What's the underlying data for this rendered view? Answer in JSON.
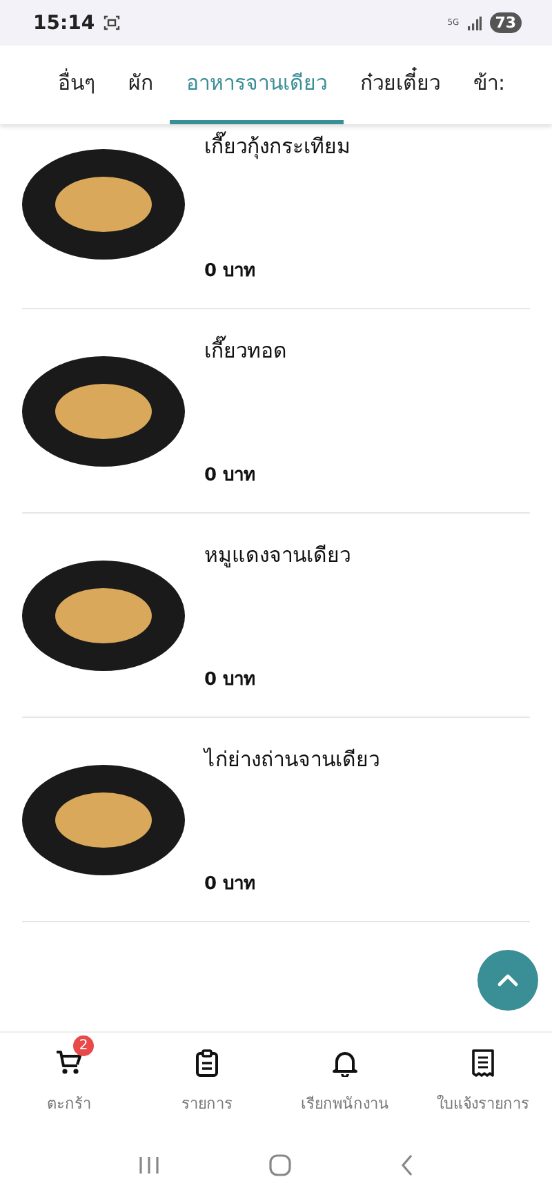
{
  "status_bar": {
    "time": "15:14",
    "network": "5G",
    "battery": "73"
  },
  "tabs": [
    {
      "label": "อื่นๆ",
      "selected": false
    },
    {
      "label": "ผัก",
      "selected": false
    },
    {
      "label": "อาหารจานเดียว",
      "selected": true
    },
    {
      "label": "ก๋วยเตี๋ยว",
      "selected": false
    },
    {
      "label": "ข้า:",
      "selected": false
    }
  ],
  "items": [
    {
      "name": "เกี๊ยวกุ้งกระเทียม",
      "price": "0 บาท"
    },
    {
      "name": "เกี๊ยวทอด",
      "price": "0 บาท"
    },
    {
      "name": "หมูแดงจานเดียว",
      "price": "0 บาท"
    },
    {
      "name": "ไก่ย่างถ่านจานเดียว",
      "price": "0 บาท"
    }
  ],
  "bottom_nav": [
    {
      "kind": "cart",
      "label": "ตะกร้า",
      "badge": "2"
    },
    {
      "kind": "list",
      "label": "รายการ"
    },
    {
      "kind": "bell",
      "label": "เรียกพนักงาน"
    },
    {
      "kind": "receipt",
      "label": "ใบแจ้งรายการ"
    }
  ]
}
